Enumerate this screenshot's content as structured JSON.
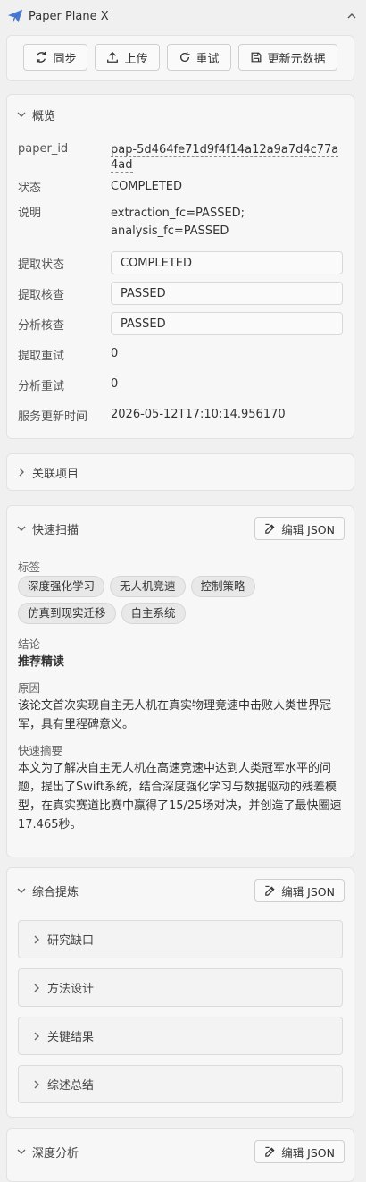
{
  "app": {
    "title": "Paper Plane X"
  },
  "toolbar": {
    "sync": "同步",
    "upload": "上传",
    "retry": "重试",
    "update_meta": "更新元数据"
  },
  "overview": {
    "title": "概览",
    "rows": [
      {
        "key": "paper_id",
        "value": "pap-5d464fe71d9f4f14a12a9a7d4c77a4ad"
      },
      {
        "key": "状态",
        "value": "COMPLETED"
      },
      {
        "key": "说明",
        "value": "extraction_fc=PASSED; analysis_fc=PASSED"
      },
      {
        "key": "提取状态",
        "value": "COMPLETED"
      },
      {
        "key": "提取核查",
        "value": "PASSED"
      },
      {
        "key": "分析核查",
        "value": "PASSED"
      },
      {
        "key": "提取重试",
        "value": "0"
      },
      {
        "key": "分析重试",
        "value": "0"
      },
      {
        "key": "服务更新时间",
        "value": "2026-05-12T17:10:14.956170"
      }
    ]
  },
  "related": {
    "title": "关联项目"
  },
  "quick_scan": {
    "title": "快速扫描",
    "edit_json": "编辑 JSON",
    "tags_label": "标签",
    "tags": [
      "深度强化学习",
      "无人机竞速",
      "控制策略",
      "仿真到现实迁移",
      "自主系统"
    ],
    "conclusion_label": "结论",
    "conclusion": "推荐精读",
    "reason_label": "原因",
    "reason": "该论文首次实现自主无人机在真实物理竞速中击败人类世界冠军，具有里程碑意义。",
    "summary_label": "快速摘要",
    "summary": "本文为了解决自主无人机在高速竞速中达到人类冠军水平的问题，提出了Swift系统，结合深度强化学习与数据驱动的残差模型，在真实赛道比赛中赢得了15/25场对决，并创造了最快圈速17.465秒。"
  },
  "synthesis": {
    "title": "综合提炼",
    "edit_json": "编辑 JSON",
    "items": [
      "研究缺口",
      "方法设计",
      "关键结果",
      "综述总结"
    ]
  },
  "deep": {
    "title": "深度分析",
    "edit_json": "编辑 JSON"
  }
}
